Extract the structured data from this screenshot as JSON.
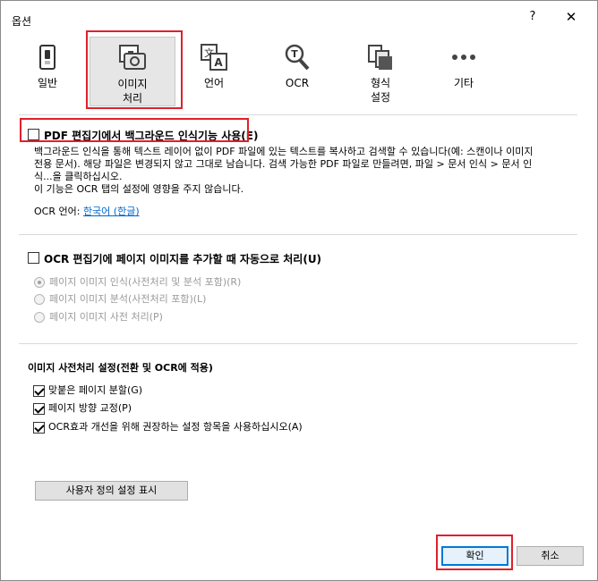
{
  "window": {
    "title": "옵션",
    "help_glyph": "?",
    "close_glyph": "✕"
  },
  "tabs": [
    {
      "label": "일반",
      "icon": "switch-icon"
    },
    {
      "label": "이미지\n처리",
      "icon": "image-camera-icon",
      "selected": true
    },
    {
      "label": "언어",
      "icon": "language-icon"
    },
    {
      "label": "OCR",
      "icon": "magnifier-text-icon"
    },
    {
      "label": "형식\n설정",
      "icon": "format-icon"
    },
    {
      "label": "기타",
      "icon": "more-icon"
    }
  ],
  "section1": {
    "checkbox_label": "PDF 편집기에서 백그라운드 인식기능 사용(E)",
    "checked": false,
    "desc_line1": "백그라운드 인식을 통해 텍스트 레이어 없이 PDF 파일에 있는 텍스트를 복사하고 검색할 수 있습니다(예: 스캔이나 이미지",
    "desc_line2": "전용 문서). 해당 파일은 변경되지 않고 그대로 남습니다. 검색 가능한 PDF 파일로 만들려면, 파일 > 문서 인식 > 문서 인",
    "desc_line3": "식...을 클릭하십시오.",
    "desc_line4": "이 기능은 OCR 탭의 설정에 영향을 주지 않습니다.",
    "ocr_lang_label": "OCR 언어:",
    "ocr_lang_link": "한국어 (한글)"
  },
  "section2": {
    "checkbox_label": "OCR 편집기에 페이지 이미지를 추가할 때 자동으로 처리(U)",
    "checked": false,
    "radios": [
      {
        "label": "페이지 이미지 인식(사전처리 및 분석 포함)(R)",
        "selected": true
      },
      {
        "label": "페이지 이미지 분석(사전처리 포함)(L)",
        "selected": false
      },
      {
        "label": "페이지 이미지 사전 처리(P)",
        "selected": false
      }
    ]
  },
  "section3": {
    "heading": "이미지 사전처리 설정(전환 및 OCR에 적용)",
    "options": [
      {
        "label": "맞붙은 페이지 분할(G)",
        "checked": true
      },
      {
        "label": "페이지 방향 교정(P)",
        "checked": true
      },
      {
        "label": "OCR효과 개선을 위해 권장하는 설정 항목을 사용하십시오(A)",
        "checked": true
      }
    ],
    "custom_button": "사용자 정의 설정 표시"
  },
  "footer": {
    "ok": "확인",
    "cancel": "취소"
  },
  "colors": {
    "highlight_border": "#e0202a",
    "link": "#0066cc",
    "selected_tab_bg": "#e6e6e6"
  }
}
